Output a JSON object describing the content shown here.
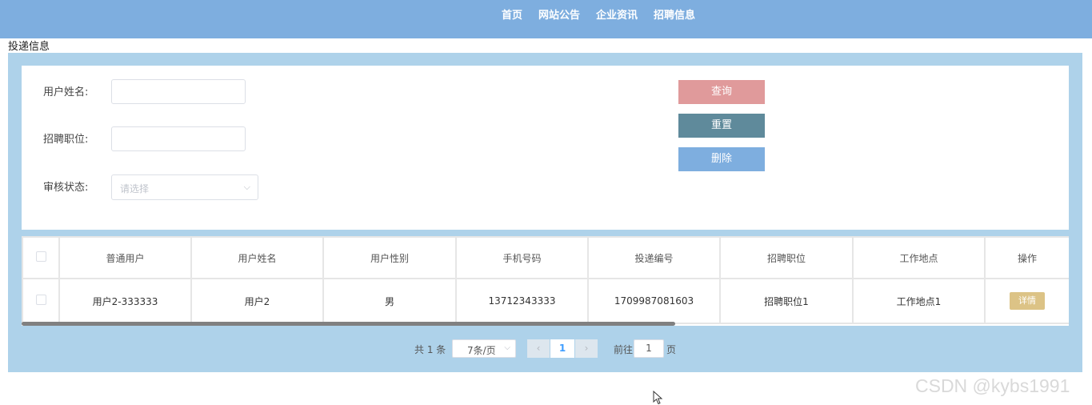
{
  "nav": {
    "items": [
      "首页",
      "网站公告",
      "企业资讯",
      "招聘信息"
    ]
  },
  "page": {
    "title": "投递信息"
  },
  "form": {
    "username_label": "用户姓名:",
    "position_label": "招聘职位:",
    "status_label": "审核状态:",
    "status_placeholder": "请选择",
    "query_button": "查询",
    "reset_button": "重置",
    "delete_button": "删除"
  },
  "table": {
    "headers": [
      "普通用户",
      "用户姓名",
      "用户性别",
      "手机号码",
      "投递编号",
      "招聘职位",
      "工作地点",
      "操作"
    ],
    "rows": [
      {
        "account": "用户2-333333",
        "name": "用户2",
        "gender": "男",
        "phone": "13712343333",
        "delivery_no": "1709987081603",
        "position": "招聘职位1",
        "location": "工作地点1",
        "action": "详情"
      }
    ]
  },
  "pagination": {
    "total": "共 1 条",
    "page_size": "7条/页",
    "current_page": "1",
    "goto_label": "前往",
    "goto_value": "1",
    "page_suffix": "页"
  },
  "watermark": "CSDN @kybs1991",
  "colors": {
    "topbar": "#7eaedf",
    "panel": "#aed2ea",
    "query": "#e09a9b",
    "reset": "#5f8a9b",
    "delete": "#7eaedf",
    "detail": "#dcc386"
  }
}
